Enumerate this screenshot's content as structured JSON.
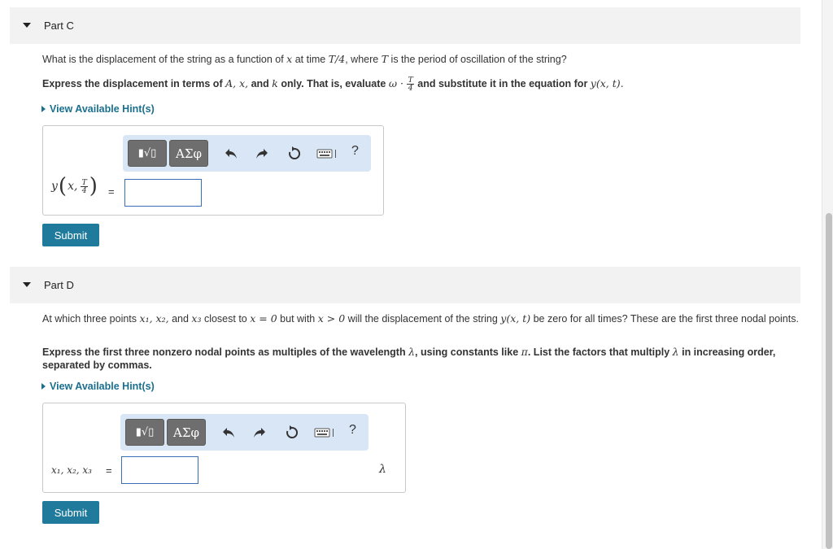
{
  "partC": {
    "title": "Part C",
    "question_pre": "What is the displacement of the string as a function of",
    "question_var_x": "x",
    "question_mid": "at time",
    "question_time": "T/4",
    "question_mid2": ", where",
    "question_var_T": "T",
    "question_post": "is the period of oscillation of the string?",
    "instruction_pre": "Express the displacement in terms of",
    "instruction_vars": "A, x,",
    "instruction_and": "and",
    "instruction_k": "k",
    "instruction_mid": "only. That is, evaluate",
    "instruction_omega": "ω ·",
    "instruction_frac_num": "T",
    "instruction_frac_den": "4",
    "instruction_post": "and substitute it in the equation for",
    "instruction_func": "y(x, t).",
    "hint_label": "View Available Hint(s)",
    "lhs_y": "y",
    "lhs_x": "x,",
    "lhs_frac_num": "T",
    "lhs_frac_den": "4",
    "equals": "=",
    "submit_label": "Submit"
  },
  "partD": {
    "title": "Part D",
    "question_pre": "At which three points",
    "question_points": "x₁, x₂,",
    "question_and": "and",
    "question_x3": "x₃",
    "question_mid": "closest to",
    "question_cond1": "x = 0",
    "question_mid2": "but with",
    "question_cond2": "x > 0",
    "question_mid3": "will the displacement of the string",
    "question_func": "y(x, t)",
    "question_post": "be zero for all times? These are the first three nodal points.",
    "instruction_pre": "Express the first three nonzero nodal points as multiples of the wavelength",
    "instruction_lambda": "λ",
    "instruction_mid": ", using constants like",
    "instruction_pi": "π",
    "instruction_mid2": ". List the factors that multiply",
    "instruction_lambda2": "λ",
    "instruction_post": "in increasing order, separated by commas.",
    "hint_label": "View Available Hint(s)",
    "lhs": "x₁, x₂, x₃",
    "equals": "=",
    "unit": "λ",
    "submit_label": "Submit"
  },
  "toolbar": {
    "template_label": "▮√▯",
    "greek_label": "ΑΣφ",
    "help_label": "?"
  }
}
